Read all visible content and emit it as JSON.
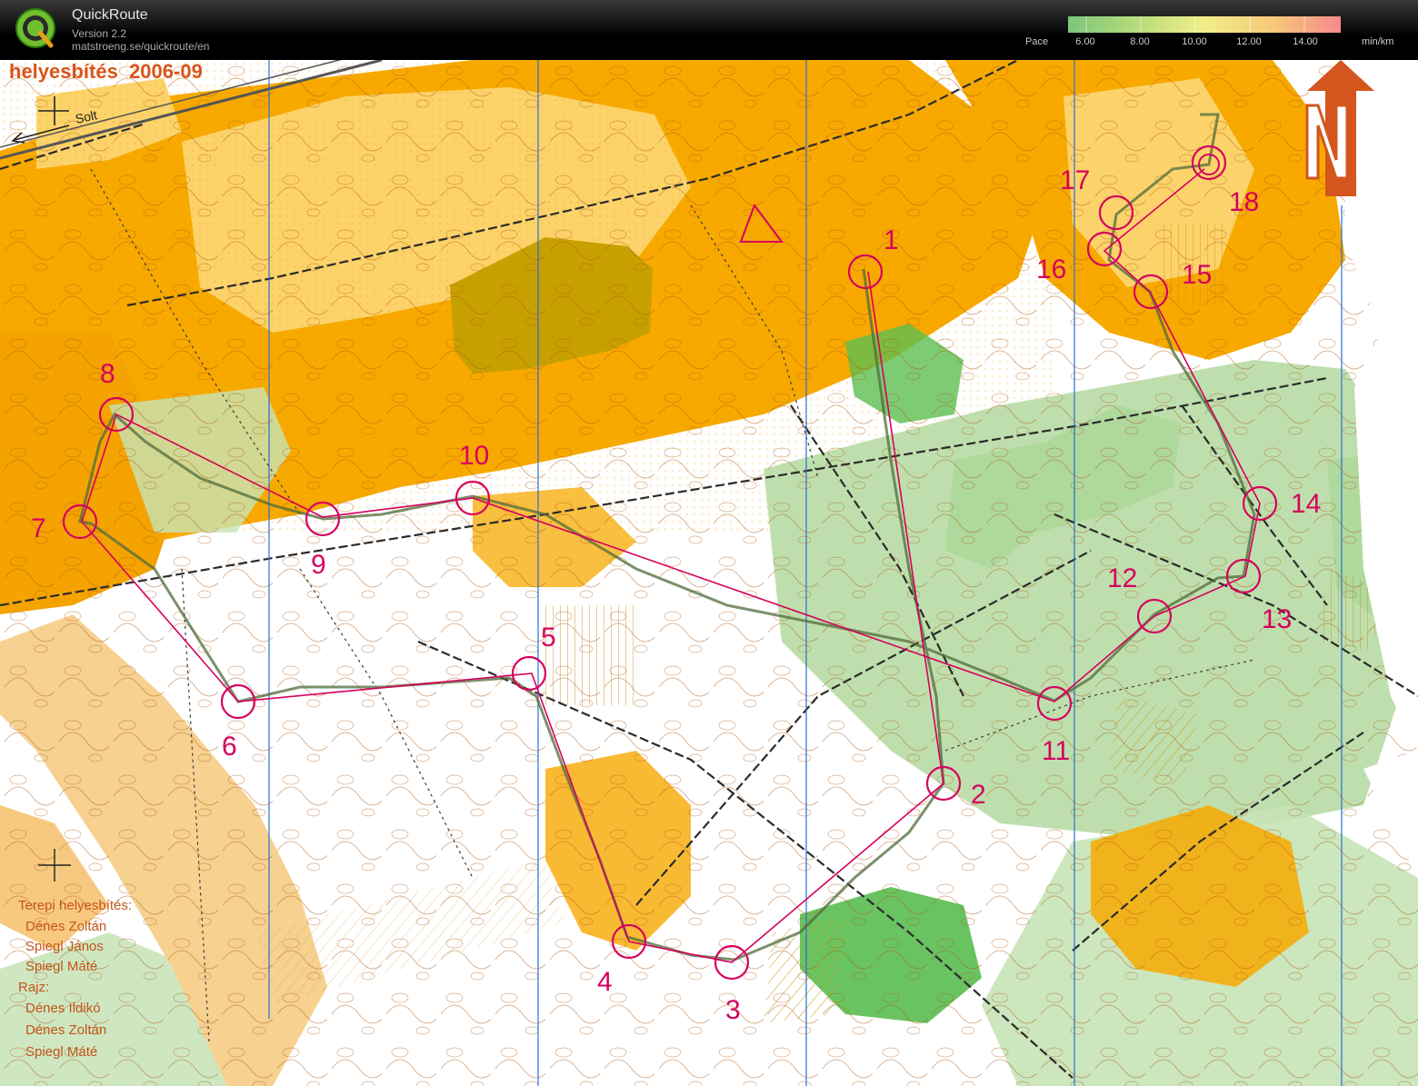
{
  "app": {
    "name": "QuickRoute",
    "version": "Version 2.2",
    "url": "matstroeng.se/quickroute/en"
  },
  "pace_legend": {
    "label": "Pace",
    "ticks": [
      "6.00",
      "8.00",
      "10.00",
      "12.00",
      "14.00"
    ],
    "unit": "min/km",
    "colors": [
      "#7bc67b",
      "#b6db7a",
      "#f2ef8a",
      "#f6c97a",
      "#f58a8a"
    ]
  },
  "map": {
    "title": "helyesbítés  2006-09",
    "road_label": "Solt",
    "credits": [
      "Terepi helyesbítés:",
      "Dénes Zoltán",
      "Spiegl János",
      "Spiegl Máté",
      "Rajz:",
      "Dénes Ildikó",
      "Dénes Zoltán",
      "Spiegl Máté"
    ],
    "colors": {
      "terrain_open": "#f7a900",
      "terrain_rough": "#fcd36a",
      "forest_green": "#3fae3a",
      "light_green": "#b7dca4",
      "course": "#d6005e",
      "contour": "#b0560f",
      "meridian": "#2a6fd6",
      "north_arrow": "#d4561e",
      "route": "#4f6b3b"
    },
    "controls": [
      {
        "label": "1"
      },
      {
        "label": "2"
      },
      {
        "label": "3"
      },
      {
        "label": "4"
      },
      {
        "label": "5"
      },
      {
        "label": "6"
      },
      {
        "label": "7"
      },
      {
        "label": "8"
      },
      {
        "label": "9"
      },
      {
        "label": "10"
      },
      {
        "label": "11"
      },
      {
        "label": "12"
      },
      {
        "label": "13"
      },
      {
        "label": "14"
      },
      {
        "label": "15"
      },
      {
        "label": "16"
      },
      {
        "label": "17"
      },
      {
        "label": "18"
      }
    ]
  }
}
